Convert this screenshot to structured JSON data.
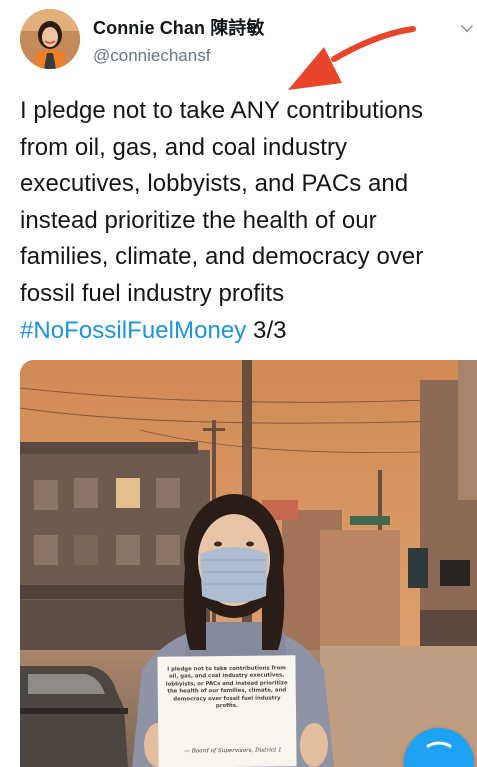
{
  "tweet": {
    "author_name": "Connie Chan 陳詩敏",
    "author_handle": "@conniechansf",
    "text_lines": [
      "I pledge not to take ANY contributions",
      "from oil, gas, and coal industry",
      "executives, lobbyists, and PACs and",
      "instead prioritize the health of our",
      "families, climate, and democracy over",
      "fossil fuel industry profits"
    ],
    "hashtag": "#NoFossilFuelMoney",
    "thread_count": " 3/3"
  },
  "photo": {
    "sign_text": "I pledge not to take contributions from oil, gas, and coal industry executives, lobbyists, or PACs and instead prioritize the health of our families, climate, and democracy over fossil fuel industry profits.",
    "sign_signature": "— Board of Supervisors, District 1"
  },
  "icons": {
    "caret": "chevron-down-icon",
    "annotation": "red-arrow-icon",
    "compose": "compose-icon"
  },
  "colors": {
    "text": "#14171a",
    "handle": "#657786",
    "hashtag": "#1b95e0",
    "arrow": "#e8452b",
    "fab": "#1da1f2",
    "sky": "#d9955f"
  }
}
